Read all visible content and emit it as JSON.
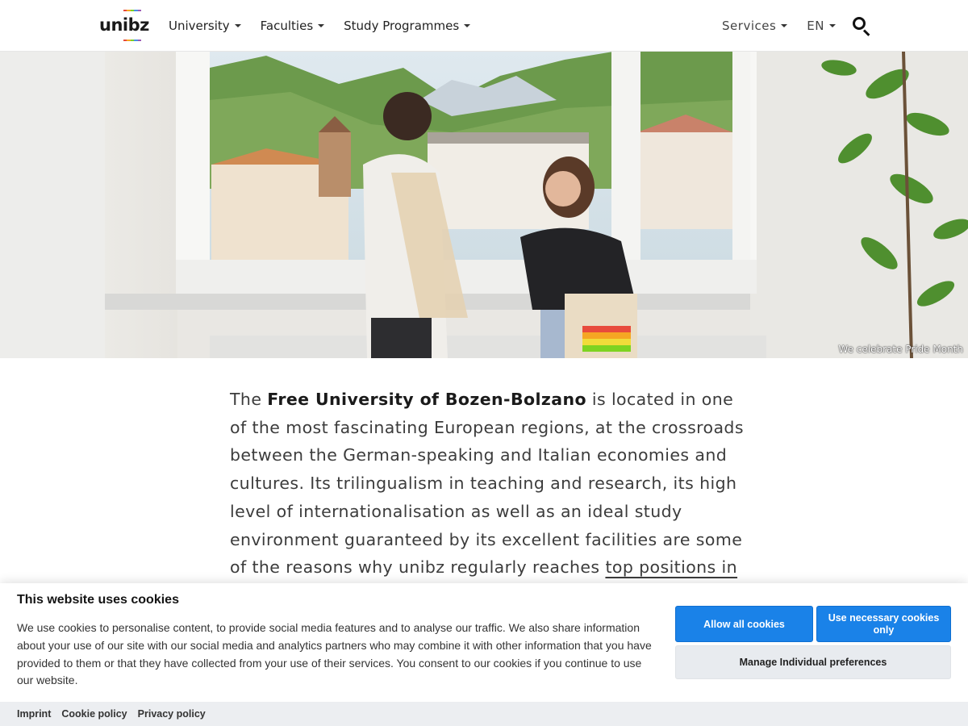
{
  "header": {
    "logo_text": "unibz",
    "nav_left": [
      {
        "label": "University"
      },
      {
        "label": "Faculties"
      },
      {
        "label": "Study Programmes"
      }
    ],
    "nav_right": [
      {
        "label": "Services"
      },
      {
        "label": "EN"
      }
    ],
    "icons": {
      "search": "search-icon"
    }
  },
  "hero": {
    "caption": "We celebrate Pride Month"
  },
  "intro": {
    "prefix": "The ",
    "bold": "Free University of Bozen-Bolzano",
    "body": " is located in one of the most fascinating European regions, at the crossroads between the German-speaking and Italian economies and cultures. Its trilingualism in teaching and research, its high level of internationalisation as well as an ideal study environment guaranteed by its excellent facilities are some of the reasons why unibz regularly reaches ",
    "link": "top positions in national and"
  },
  "cookie_banner": {
    "title": "This website uses cookies",
    "text": "We use cookies to personalise content, to provide social media features and to analyse our traffic. We also share information about your use of our site with our social media and analytics partners who may combine it with other information that you have provided to them or that they have collected from your use of their services. You consent to our cookies if you continue to use our website.",
    "allow_all": "Allow all cookies",
    "necessary_only": "Use necessary cookies only",
    "manage": "Manage Individual preferences",
    "footer_links": [
      "Imprint",
      "Cookie policy",
      "Privacy policy"
    ]
  },
  "colors": {
    "primary_button": "#1a82e8",
    "secondary_button": "#e8ebef",
    "logo_stripes": [
      "#e84b3c",
      "#f5a623",
      "#7ed321",
      "#4a90e2",
      "#9b59b6"
    ]
  }
}
